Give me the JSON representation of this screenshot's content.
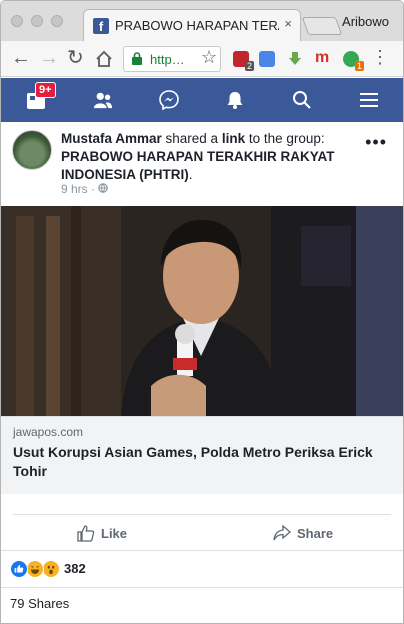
{
  "browser": {
    "tab_title": "PRABOWO HARAPAN TERAKHIR RAKYAT INDONESIA (PHTRI)",
    "tab_close": "×",
    "profile_name": "Aribowo",
    "url_text": "http…",
    "ext_badge_1": "2",
    "ext_badge_2": "1"
  },
  "fb_nav": {
    "notification_badge": "9+"
  },
  "post": {
    "author": "Mustafa Ammar",
    "action_text": " shared a ",
    "link_word": "link",
    "to_group": " to the group:",
    "group_name": "PRABOWO HARAPAN TERAKHIR RAKYAT INDONESIA (PHTRI)",
    "period": ".",
    "time": "9 hrs",
    "more": "•••",
    "link_domain": "jawapos.com",
    "link_title": "Usut Korupsi Asian Games, Polda Metro Periksa Erick Tohir",
    "like_label": "Like",
    "share_label": "Share",
    "reaction_count": "382",
    "shares_text": "79 Shares"
  },
  "colors": {
    "facebook_blue": "#3b5998",
    "badge_red": "#e41e3f",
    "url_green": "#188038"
  }
}
